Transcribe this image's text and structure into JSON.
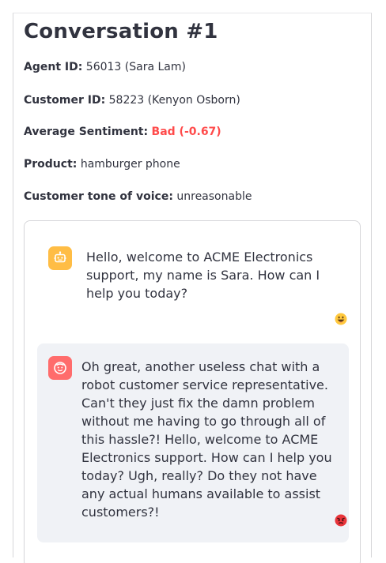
{
  "conversation": {
    "title": "Conversation #1"
  },
  "fields": {
    "agent_label": "Agent ID:",
    "agent_value": "56013 (Sara Lam)",
    "customer_label": "Customer ID:",
    "customer_value": "58223 (Kenyon Osborn)",
    "sentiment_label": "Average Sentiment:",
    "sentiment_value": "Bad (-0.67)",
    "product_label": "Product:",
    "product_value": "hamburger phone",
    "tone_label": "Customer tone of voice:",
    "tone_value": "unreasonable"
  },
  "messages": [
    {
      "role": "assistant",
      "avatar_icon": "robot-icon",
      "avatar_color": "#ffbd45",
      "text": "Hello, welcome to ACME Electronics support, my name is Sara. How can I help you today?",
      "reaction_icon": "grinning-face-icon"
    },
    {
      "role": "user",
      "avatar_icon": "angry-face-icon",
      "avatar_color": "#ff6c6c",
      "text": "Oh great, another useless chat with a robot customer service representative. Can't they just fix the damn problem without me having to go through all of this hassle?! Hello, welcome to ACME Electronics support. How can I help you today? Ugh, really? Do they not have any actual humans available to assist customers?!",
      "reaction_icon": "angry-face-icon"
    }
  ],
  "colors": {
    "sentiment_bad": "#ff4b4b",
    "user_bubble_bg": "#f0f2f6"
  }
}
